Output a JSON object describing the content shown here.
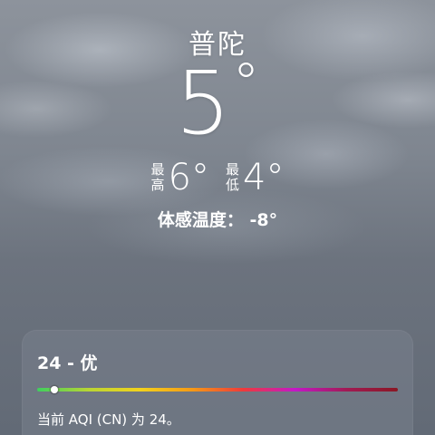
{
  "location": {
    "city": "普陀"
  },
  "current": {
    "temperature": "5",
    "degree_symbol": "°"
  },
  "high_low": {
    "high_label_top": "最",
    "high_label_bottom": "高",
    "high_value": "6°",
    "low_label_top": "最",
    "low_label_bottom": "低",
    "low_value": "4°"
  },
  "feels_like": {
    "text": "体感温度： -8°"
  },
  "aqi": {
    "title": "24 - 优",
    "value": 24,
    "scale_max": 500,
    "indicator_fraction": 0.048,
    "description": "当前 AQI (CN) 为 24。",
    "gradient_colors": [
      "#3ecf5e",
      "#b9d534",
      "#f2d21c",
      "#f59a16",
      "#ef3a3a",
      "#c418c8",
      "#a11a54",
      "#8a1824"
    ]
  }
}
